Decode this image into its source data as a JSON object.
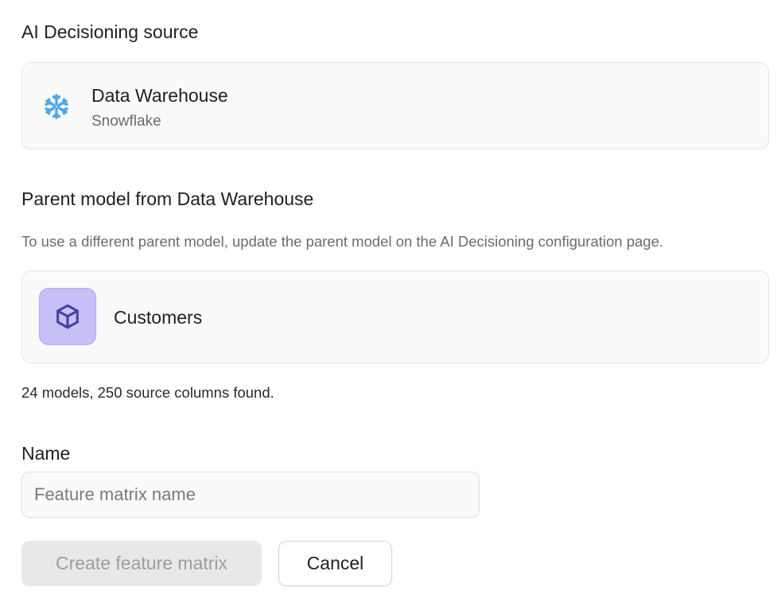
{
  "source_section": {
    "heading": "AI Decisioning source",
    "title": "Data Warehouse",
    "subtitle": "Snowflake",
    "icon": "snowflake-icon",
    "icon_color": "#4aa8e6"
  },
  "parent_section": {
    "heading": "Parent model from Data Warehouse",
    "help_text": "To use a different parent model, update the parent model on the AI Decisioning configuration page.",
    "model_name": "Customers",
    "icon": "cube-icon",
    "icon_bg": "#c7c0f7",
    "icon_color": "#4b3f9e",
    "found_text": "24 models, 250 source columns found."
  },
  "name_field": {
    "label": "Name",
    "placeholder": "Feature matrix name",
    "value": ""
  },
  "actions": {
    "create_label": "Create feature matrix",
    "cancel_label": "Cancel"
  }
}
